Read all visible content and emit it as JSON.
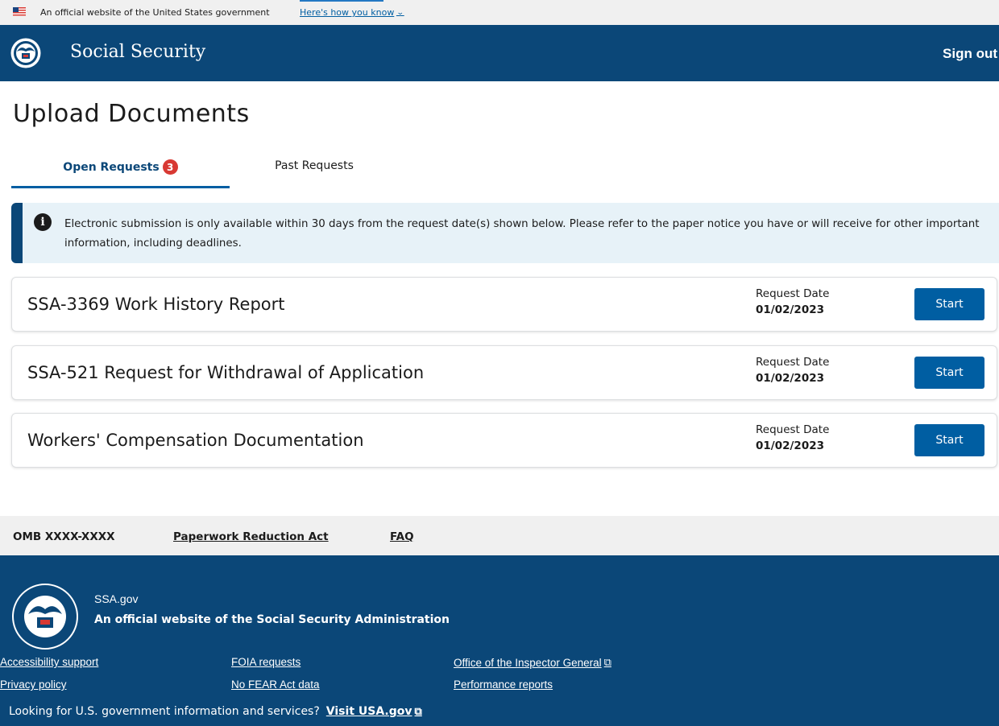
{
  "gov_banner": {
    "text": "An official website of the United States government",
    "link": "Here's how you know"
  },
  "header": {
    "brand": "Social Security",
    "sign_out": "Sign out"
  },
  "page": {
    "title": "Upload Documents"
  },
  "tabs": {
    "open_label": "Open Requests",
    "open_count": "3",
    "past_label": "Past Requests"
  },
  "alert": {
    "text": "Electronic submission is only available within 30 days from the request date(s) shown below. Please refer to the paper notice you have or will receive for other important information, including deadlines."
  },
  "requests": [
    {
      "title": "SSA-3369 Work History Report",
      "date_label": "Request Date",
      "date": "01/02/2023",
      "button": "Start"
    },
    {
      "title": "SSA-521 Request for Withdrawal of Application",
      "date_label": "Request Date",
      "date": "01/02/2023",
      "button": "Start"
    },
    {
      "title": "Workers' Compensation Documentation",
      "date_label": "Request Date",
      "date": "01/02/2023",
      "button": "Start"
    }
  ],
  "footer_links": {
    "omb": "OMB XXXX-XXXX",
    "paperwork": "Paperwork Reduction Act",
    "faq": "FAQ"
  },
  "footer": {
    "site": "SSA.gov",
    "official": "An official website of the Social Security Administration",
    "links": {
      "accessibility": "Accessibility support",
      "foia": "FOIA requests",
      "oig": "Office of the Inspector General",
      "privacy": "Privacy policy",
      "nofear": "No FEAR Act data",
      "performance": "Performance reports"
    },
    "looking": "Looking for U.S. government information and services?",
    "visit": "Visit USA.gov"
  },
  "colors": {
    "navy": "#0b4778",
    "primary_blue": "#005ea2",
    "badge_red": "#d83933",
    "alert_bg": "#e7f2f8"
  }
}
